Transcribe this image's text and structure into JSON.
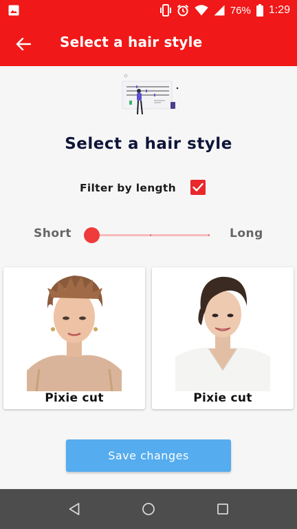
{
  "status_bar": {
    "battery_percent": "76%",
    "time": "1:29",
    "icons": [
      "image-icon",
      "vibrate-icon",
      "alarm-icon",
      "wifi-icon",
      "signal-icon",
      "battery-icon"
    ]
  },
  "app_bar": {
    "title": "Select a hair style",
    "back_icon": "arrow-left-icon"
  },
  "content": {
    "heading": "Select a hair style",
    "filter": {
      "label": "Filter by length",
      "checked": true
    },
    "slider": {
      "min_label": "Short",
      "max_label": "Long",
      "value": 0.0
    },
    "styles": [
      {
        "label": "Pixie cut"
      },
      {
        "label": "Pixie cut"
      }
    ],
    "save_button": "Save changes"
  },
  "nav_bar": {
    "icons": [
      "back-triangle-icon",
      "home-circle-icon",
      "recent-square-icon"
    ]
  },
  "colors": {
    "primary": "#f01818",
    "accent": "#55acee",
    "heading": "#0e1538",
    "slider_active": "#ef3b3b"
  }
}
